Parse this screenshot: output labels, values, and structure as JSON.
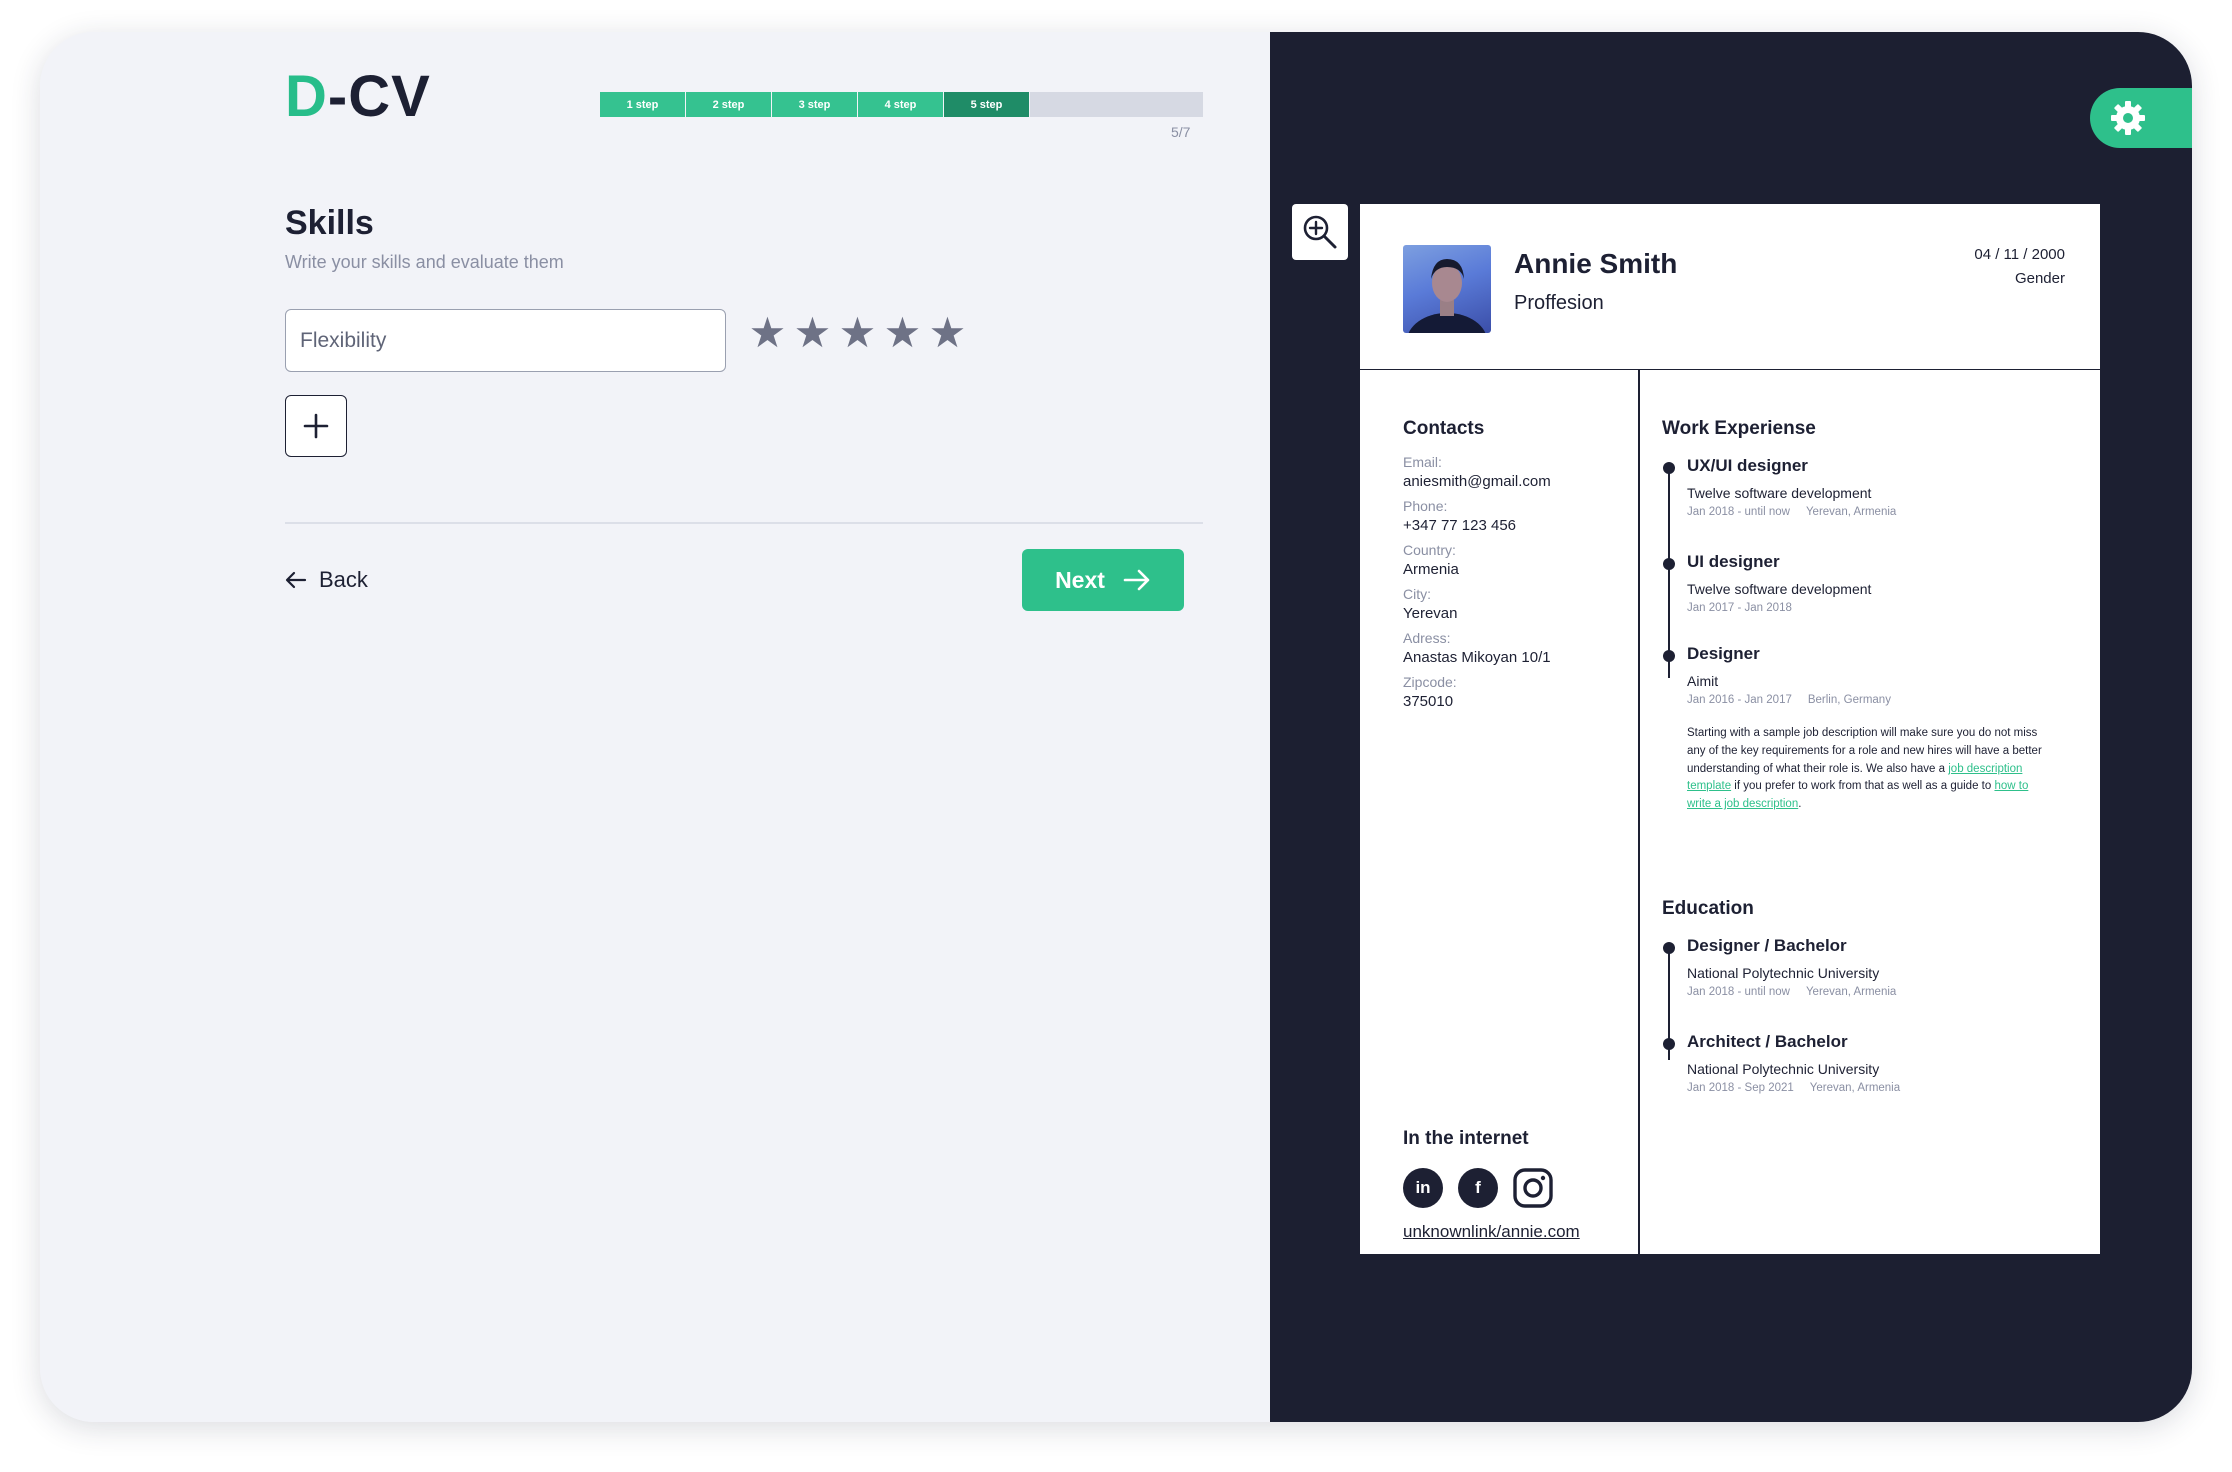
{
  "logo": {
    "first": "D",
    "rest": "-CV"
  },
  "progress": {
    "steps": [
      "1 step",
      "2 step",
      "3 step",
      "4 step",
      "5 step"
    ],
    "current": 5,
    "total": 7,
    "count_label": "5/7",
    "completed_color": "#35c290",
    "active_color": "#1f8c67"
  },
  "skills": {
    "title": "Skills",
    "subtitle": "Write your skills and evaluate them",
    "input_value": "Flexibility",
    "rating": 0,
    "max_rating": 5,
    "star_glyph": "★"
  },
  "nav": {
    "back_label": "Back",
    "next_label": "Next"
  },
  "resume": {
    "name": "Annie Smith",
    "profession": "Proffesion",
    "date": "04 / 11 / 2000",
    "gender": "Gender",
    "contacts": {
      "heading": "Contacts",
      "email_label": "Email:",
      "email": "aniesmith@gmail.com",
      "phone_label": "Phone:",
      "phone": "+347 77 123 456",
      "country_label": "Country:",
      "country": "Armenia",
      "city_label": "City:",
      "city": "Yerevan",
      "address_label": "Adress:",
      "address": "Anastas Mikoyan 10/1",
      "zip_label": "Zipcode:",
      "zip": "375010"
    },
    "internet": {
      "heading": "In the internet",
      "socials": [
        "in",
        "f"
      ],
      "link": "unknownlink/annie.com"
    },
    "work": {
      "heading": "Work Experiense",
      "items": [
        {
          "title": "UX/UI designer",
          "company": "Twelve software development",
          "period": "Jan 2018 - until now",
          "location": "Yerevan, Armenia"
        },
        {
          "title": "UI designer",
          "company": "Twelve software development",
          "period": "Jan 2017 - Jan 2018",
          "location": ""
        },
        {
          "title": "Designer",
          "company": "Aimit",
          "period": "Jan 2016 - Jan 2017",
          "location": "Berlin, Germany",
          "desc_1": "Starting with a sample job description will make sure you do not miss any of the key requirements for a role and new hires will have a better understanding of what their role is. We also have a ",
          "desc_link_1": "job description template",
          "desc_2": " if you prefer to work from that as well as a guide to ",
          "desc_link_2": "how to write a job description",
          "desc_3": "."
        }
      ]
    },
    "education": {
      "heading": "Education",
      "items": [
        {
          "title": "Designer / Bachelor",
          "school": "National Polytechnic University",
          "period": "Jan 2018 - until now",
          "location": "Yerevan, Armenia"
        },
        {
          "title": "Architect / Bachelor",
          "school": "National Polytechnic University",
          "period": "Jan 2018 - Sep 2021",
          "location": "Yerevan, Armenia"
        }
      ]
    }
  },
  "icons": {
    "add": "plus-icon",
    "back": "arrow-left-icon",
    "next": "arrow-right-icon",
    "settings": "gear-icon",
    "zoom": "zoom-in-icon",
    "social": [
      "linkedin-icon",
      "facebook-icon",
      "instagram-icon"
    ]
  },
  "colors": {
    "accent": "#2ec08b",
    "dark": "#1c1f31",
    "text": "#1d2033",
    "muted": "#8a8fa3",
    "panel": "#f2f3f8"
  }
}
